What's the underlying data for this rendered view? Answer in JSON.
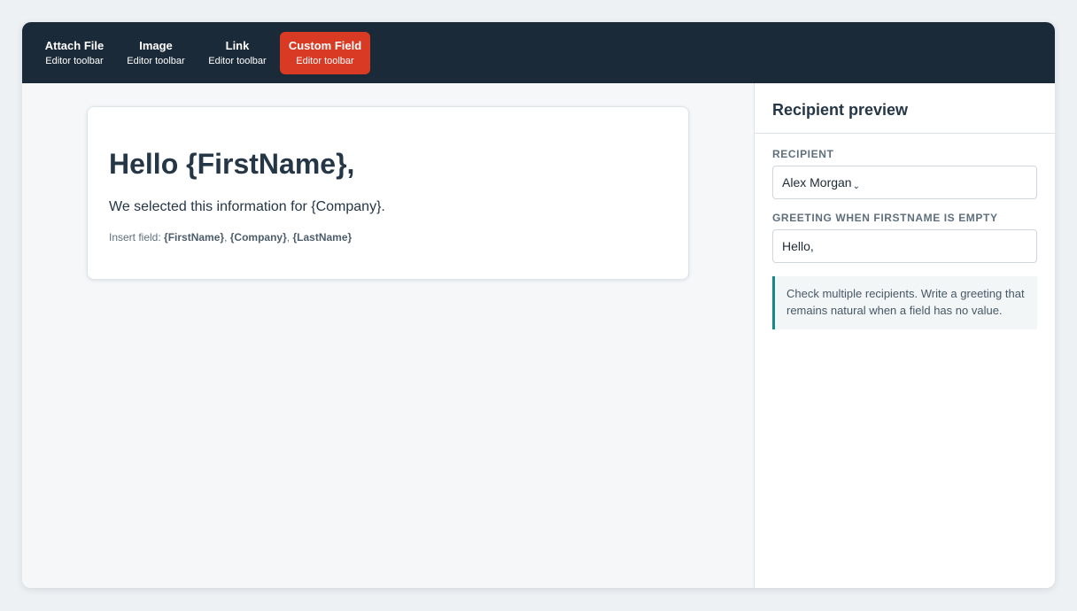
{
  "toolbar": {
    "items": [
      {
        "label": "Attach File",
        "sub": "Editor toolbar"
      },
      {
        "label": "Image",
        "sub": "Editor toolbar"
      },
      {
        "label": "Link",
        "sub": "Editor toolbar"
      },
      {
        "label": "Custom Field",
        "sub": "Editor toolbar",
        "active": true
      }
    ],
    "active_color": "#d93a24",
    "background_color": "#1b2a38"
  },
  "editor": {
    "heading": "Hello {FirstName},",
    "body": "We selected this information for {Company}.",
    "insert_label": "Insert field:",
    "insert_fields": [
      "{FirstName}",
      "{Company}",
      "{LastName}"
    ],
    "separator": ","
  },
  "panel": {
    "title": "Recipient preview",
    "recipient_label": "RECIPIENT",
    "recipient_value": "Alex Morgan",
    "recipient_chevron": "⌄",
    "greeting_label": "GREETING WHEN FIRSTNAME IS EMPTY",
    "greeting_value": "Hello,",
    "tip": "Check multiple recipients. Write a greeting that remains natural when a field has no value.",
    "tip_accent_color": "#138a86"
  }
}
